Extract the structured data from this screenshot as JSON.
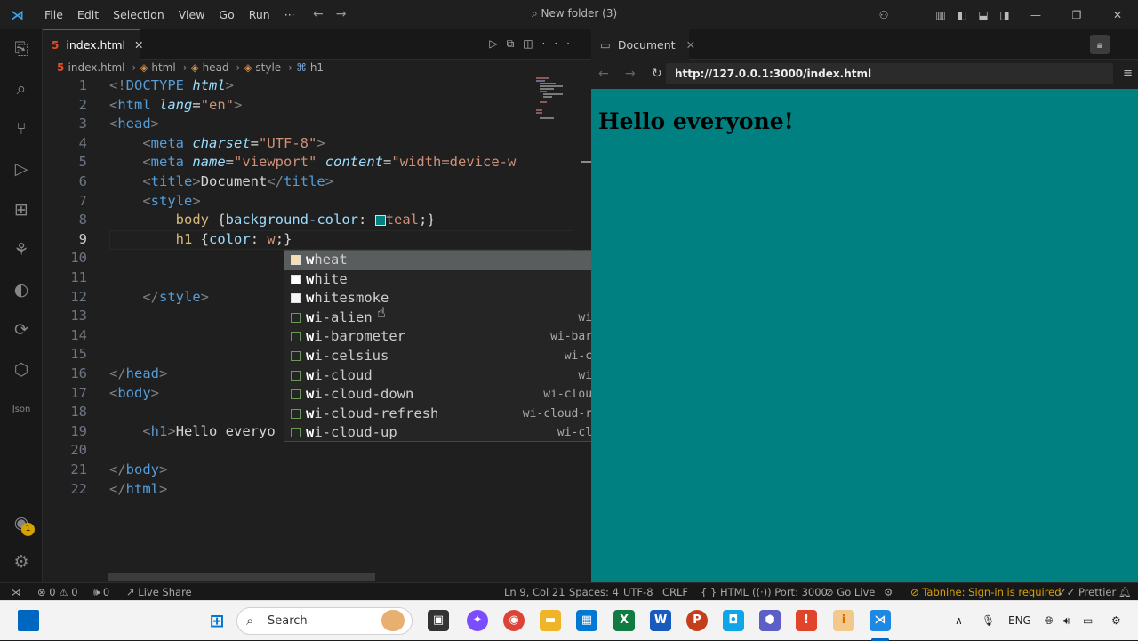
{
  "titlebar": {
    "menu": [
      "File",
      "Edit",
      "Selection",
      "View",
      "Go",
      "Run",
      "···"
    ],
    "command_center": "New folder (3)"
  },
  "editor_tab": {
    "label": "index.html",
    "icon": "html5-icon",
    "close": "✕"
  },
  "breadcrumb": [
    "index.html",
    "html",
    "head",
    "style",
    "h1"
  ],
  "code_lines": [
    {
      "n": "1",
      "html": "<span class='t-pun'>&lt;!</span><span class='t-tag'>DOCTYPE</span> <span class='t-attr'><i>html</i></span><span class='t-pun'>&gt;</span>"
    },
    {
      "n": "2",
      "html": "<span class='t-pun'>&lt;</span><span class='t-tag'>html</span> <span class='t-attr'><i>lang</i></span><span class='t-txt'>=</span><span class='t-str'>\"en\"</span><span class='t-pun'>&gt;</span>"
    },
    {
      "n": "3",
      "html": "<span class='t-pun'>&lt;</span><span class='t-tag'>head</span><span class='t-pun'>&gt;</span>"
    },
    {
      "n": "4",
      "html": "    <span class='t-pun'>&lt;</span><span class='t-tag'>meta</span> <span class='t-attr'><i>charset</i></span><span class='t-txt'>=</span><span class='t-str'>\"UTF-8\"</span><span class='t-pun'>&gt;</span>"
    },
    {
      "n": "5",
      "html": "    <span class='t-pun'>&lt;</span><span class='t-tag'>meta</span> <span class='t-attr'><i>name</i></span><span class='t-txt'>=</span><span class='t-str'>\"viewport\"</span> <span class='t-attr'><i>content</i></span><span class='t-txt'>=</span><span class='t-str'>\"width=device-w</span>"
    },
    {
      "n": "6",
      "html": "    <span class='t-pun'>&lt;</span><span class='t-tag'>title</span><span class='t-pun'>&gt;</span><span class='t-txt'>Document</span><span class='t-pun'>&lt;/</span><span class='t-tag'>title</span><span class='t-pun'>&gt;</span>"
    },
    {
      "n": "7",
      "html": "    <span class='t-pun'>&lt;</span><span class='t-tag'>style</span><span class='t-pun'>&gt;</span>"
    },
    {
      "n": "8",
      "html": "        <span style='color:#d7ba7d'>body</span> <span class='t-txt'>{</span><span class='t-attr'>background-color</span><span class='t-txt'>: </span><span style='display:inline-block;width:12px;height:12px;background:#008080;border:1px solid #ddd;vertical-align:middle'></span><span style='color:#ce9178'>teal</span><span class='t-txt'>;}</span>"
    },
    {
      "n": "9",
      "html": "        <span style='color:#d7ba7d'>h1</span> <span class='t-txt'>{</span><span class='t-attr'>color</span><span class='t-txt'>: </span><span style='color:#ce9178'>w</span><span class='t-txt'>;}</span>"
    },
    {
      "n": "10",
      "html": ""
    },
    {
      "n": "11",
      "html": ""
    },
    {
      "n": "12",
      "html": "    <span class='t-pun'>&lt;/</span><span class='t-tag'>style</span><span class='t-pun'>&gt;</span>"
    },
    {
      "n": "13",
      "html": ""
    },
    {
      "n": "14",
      "html": ""
    },
    {
      "n": "15",
      "html": ""
    },
    {
      "n": "16",
      "html": "<span class='t-pun'>&lt;/</span><span class='t-tag'>head</span><span class='t-pun'>&gt;</span>"
    },
    {
      "n": "17",
      "html": "<span class='t-pun'>&lt;</span><span class='t-tag'>body</span><span class='t-pun'>&gt;</span>"
    },
    {
      "n": "18",
      "html": ""
    },
    {
      "n": "19",
      "html": "    <span class='t-pun'>&lt;</span><span class='t-tag'>h1</span><span class='t-pun'>&gt;</span><span class='t-txt'>Hello everyo</span>"
    },
    {
      "n": "20",
      "html": ""
    },
    {
      "n": "21",
      "html": "<span class='t-pun'>&lt;/</span><span class='t-tag'>body</span><span class='t-pun'>&gt;</span>"
    },
    {
      "n": "22",
      "html": "<span class='t-pun'>&lt;/</span><span class='t-tag'>html</span><span class='t-pun'>&gt;</span>"
    }
  ],
  "suggestions": [
    {
      "label": "wheat",
      "detail": "",
      "swatch": "#f5deb3",
      "selected": true
    },
    {
      "label": "white",
      "detail": "",
      "swatch": "#ffffff",
      "selected": false
    },
    {
      "label": "whitesmoke",
      "detail": "",
      "swatch": "#f5f5f5",
      "selected": false
    },
    {
      "label": "wi-alien",
      "detail": "wi-alien",
      "swatch": "",
      "selected": false
    },
    {
      "label": "wi-barometer",
      "detail": "wi-barometer",
      "swatch": "",
      "selected": false
    },
    {
      "label": "wi-celsius",
      "detail": "wi-celsius",
      "swatch": "",
      "selected": false
    },
    {
      "label": "wi-cloud",
      "detail": "wi-cloud",
      "swatch": "",
      "selected": false
    },
    {
      "label": "wi-cloud-down",
      "detail": "wi-cloud-down",
      "swatch": "",
      "selected": false
    },
    {
      "label": "wi-cloud-refresh",
      "detail": "wi-cloud-refresh",
      "swatch": "",
      "selected": false
    },
    {
      "label": "wi-cloud-up",
      "detail": "wi-cloud-up",
      "swatch": "",
      "selected": false
    }
  ],
  "browser": {
    "tab_label": "Document",
    "url": "http://127.0.0.1:3000/index.html",
    "heading": "Hello everyone!",
    "background": "#008080"
  },
  "statusbar": {
    "problems": "⊗ 0 ⚠ 0",
    "ports": "🕪 0",
    "live_share": "Live Share",
    "position": "Ln 9, Col 21",
    "spaces": "Spaces: 4",
    "encoding": "UTF-8",
    "eol": "CRLF",
    "language": "HTML",
    "port": "Port: 3000",
    "go_live": "Go Live",
    "tabnine": "Tabnine: Sign-in is required",
    "prettier": "Prettier"
  },
  "taskbar": {
    "search_placeholder": "Search",
    "lang": "ENG"
  },
  "colors": {
    "accent": "#0078d4",
    "teal": "#008080"
  }
}
